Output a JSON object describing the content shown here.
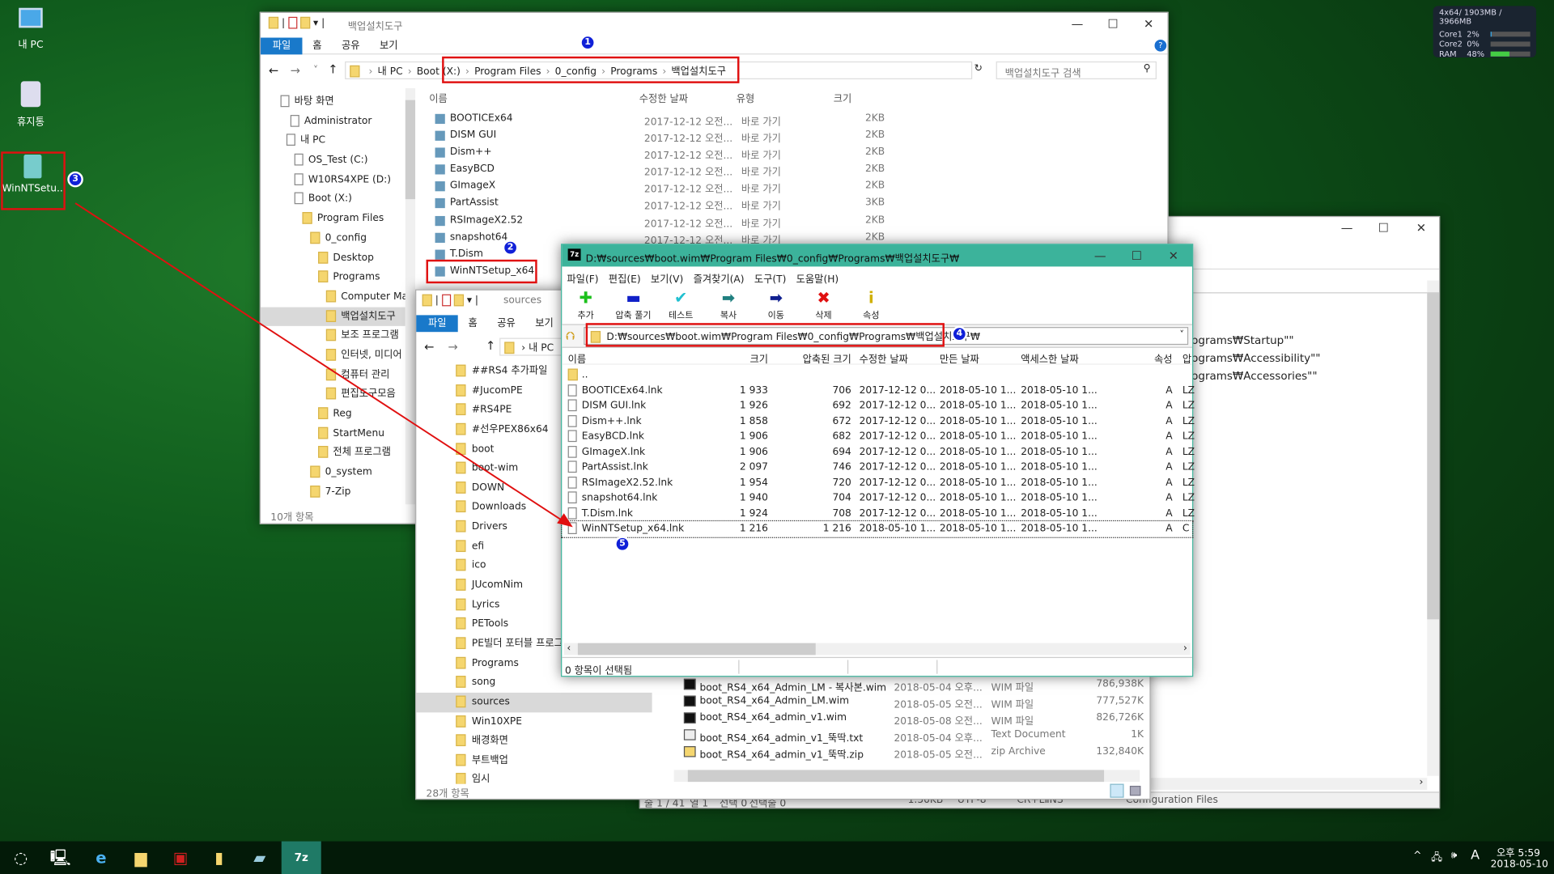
{
  "desktop": {
    "icons": [
      {
        "label": "내 PC",
        "icon": "computer-icon"
      },
      {
        "label": "휴지통",
        "icon": "recycle-bin-icon"
      },
      {
        "label": "WinNTSetu...",
        "icon": "winntsetup-icon"
      }
    ]
  },
  "sysmon": {
    "title": "4x64/ 1903MB / 3966MB",
    "rows": [
      {
        "label": "Core1",
        "value": "2%",
        "level": 2
      },
      {
        "label": "Core2",
        "value": "0%",
        "level": 0
      },
      {
        "label": "RAM",
        "value": "48%",
        "level": 48
      }
    ]
  },
  "explorer1": {
    "title": "백업설치도구",
    "tabs": [
      "파일",
      "홈",
      "공유",
      "보기"
    ],
    "breadcrumb": [
      "내 PC",
      "Boot (X:)",
      "Program Files",
      "0_config",
      "Programs",
      "백업설치도구"
    ],
    "search_placeholder": "백업설치도구 검색",
    "nav": [
      "바탕 화면",
      "Administrator",
      "내 PC",
      "OS_Test (C:)",
      "W10RS4XPE (D:)",
      "Boot (X:)",
      "Program Files",
      "0_config",
      "Desktop",
      "Programs",
      "Computer Man",
      "백업설치도구",
      "보조 프로그램",
      "인터넷, 미디어",
      "컴퓨터 관리",
      "편집도구모음",
      "Reg",
      "StartMenu",
      "전체 프로그램",
      "0_system",
      "7-Zip"
    ],
    "columns": [
      "이름",
      "수정한 날짜",
      "유형",
      "크기"
    ],
    "files": [
      {
        "name": "BOOTICEx64",
        "date": "2017-12-12 오전...",
        "type": "바로 가기",
        "size": "2KB"
      },
      {
        "name": "DISM GUI",
        "date": "2017-12-12 오전...",
        "type": "바로 가기",
        "size": "2KB"
      },
      {
        "name": "Dism++",
        "date": "2017-12-12 오전...",
        "type": "바로 가기",
        "size": "2KB"
      },
      {
        "name": "EasyBCD",
        "date": "2017-12-12 오전...",
        "type": "바로 가기",
        "size": "2KB"
      },
      {
        "name": "GImageX",
        "date": "2017-12-12 오전...",
        "type": "바로 가기",
        "size": "2KB"
      },
      {
        "name": "PartAssist",
        "date": "2017-12-12 오전...",
        "type": "바로 가기",
        "size": "3KB"
      },
      {
        "name": "RSImageX2.52",
        "date": "2017-12-12 오전...",
        "type": "바로 가기",
        "size": "2KB"
      },
      {
        "name": "snapshot64",
        "date": "2017-12-12 오전...",
        "type": "바로 가기",
        "size": "2KB"
      },
      {
        "name": "T.Dism",
        "date": "",
        "type": "",
        "size": ""
      },
      {
        "name": "WinNTSetup_x64",
        "date": "",
        "type": "",
        "size": ""
      }
    ],
    "status": "10개 항목"
  },
  "notepad": {
    "lines": [
      "rograms₩Startup\"\"",
      "rograms₩Accessibility\"\"",
      "rograms₩Accessories\"\""
    ],
    "status": [
      "줄 1 / 41",
      "열 1",
      "선택 0",
      "선택줄 0",
      "1.50KB",
      "UTF-8",
      "CR+LF",
      "INS",
      "Configuration Files"
    ]
  },
  "explorer2": {
    "title": "sources",
    "tabs": [
      "파일",
      "홈",
      "공유",
      "보기"
    ],
    "breadcrumb": [
      "내 PC"
    ],
    "nav": [
      "##RS4 추가파일",
      "#JucomPE",
      "#RS4PE",
      "#선우PEX86x64",
      "boot",
      "boot-wim",
      "DOWN",
      "Downloads",
      "Drivers",
      "efi",
      "ico",
      "JUcomNim",
      "Lyrics",
      "PETools",
      "PE빌더 포터블 프로그",
      "Programs",
      "song",
      "sources",
      "Win10XPE",
      "배경화면",
      "부트백업",
      "임시"
    ],
    "files": [
      {
        "name": "boot_RS4_x64_Admin_LM - 복사본.wim",
        "date": "2018-05-04 오후...",
        "type": "WIM 파일",
        "size": "786,938K"
      },
      {
        "name": "boot_RS4_x64_Admin_LM.wim",
        "date": "2018-05-05 오전...",
        "type": "WIM 파일",
        "size": "777,527K"
      },
      {
        "name": "boot_RS4_x64_admin_v1.wim",
        "date": "2018-05-08 오전...",
        "type": "WIM 파일",
        "size": "826,726K"
      },
      {
        "name": "boot_RS4_x64_admin_v1_뚝딱.txt",
        "date": "2018-05-04 오후...",
        "type": "Text Document",
        "size": "1K"
      },
      {
        "name": "boot_RS4_x64_admin_v1_뚝딱.zip",
        "date": "2018-05-05 오전...",
        "type": "zip Archive",
        "size": "132,840K"
      }
    ],
    "status": "28개 항목"
  },
  "sevenzip": {
    "title": "D:₩sources₩boot.wim₩Program Files₩0_config₩Programs₩백업설치도구₩",
    "menu": [
      "파일(F)",
      "편집(E)",
      "보기(V)",
      "즐겨찾기(A)",
      "도구(T)",
      "도움말(H)"
    ],
    "toolbar": [
      {
        "label": "추가",
        "icon": "add-icon",
        "glyph": "✚",
        "color": "#1bc01b"
      },
      {
        "label": "압축 풀기",
        "icon": "extract-icon",
        "glyph": "▬",
        "color": "#1020c8"
      },
      {
        "label": "테스트",
        "icon": "test-icon",
        "glyph": "✔",
        "color": "#20c0d0"
      },
      {
        "label": "복사",
        "icon": "copy-icon",
        "glyph": "➡",
        "color": "#208080"
      },
      {
        "label": "이동",
        "icon": "move-icon",
        "glyph": "➡",
        "color": "#102090"
      },
      {
        "label": "삭제",
        "icon": "delete-icon",
        "glyph": "✖",
        "color": "#e01010"
      },
      {
        "label": "속성",
        "icon": "info-icon",
        "glyph": "i",
        "color": "#d0b000"
      }
    ],
    "path": "D:₩sources₩boot.wim₩Program Files₩0_config₩Programs₩백업설치도구₩",
    "columns": [
      "이름",
      "크기",
      "압축된 크기",
      "수정한 날짜",
      "만든 날짜",
      "액세스한 날짜",
      "속성",
      "압"
    ],
    "parent": "..",
    "files": [
      {
        "name": "BOOTICEx64.lnk",
        "size": "1 933",
        "packed": "706",
        "modified": "2017-12-12 0...",
        "created": "2018-05-10 1...",
        "accessed": "2018-05-10 1...",
        "attr": "A",
        "method": "LZ"
      },
      {
        "name": "DISM GUI.lnk",
        "size": "1 926",
        "packed": "692",
        "modified": "2017-12-12 0...",
        "created": "2018-05-10 1...",
        "accessed": "2018-05-10 1...",
        "attr": "A",
        "method": "LZ"
      },
      {
        "name": "Dism++.lnk",
        "size": "1 858",
        "packed": "672",
        "modified": "2017-12-12 0...",
        "created": "2018-05-10 1...",
        "accessed": "2018-05-10 1...",
        "attr": "A",
        "method": "LZ"
      },
      {
        "name": "EasyBCD.lnk",
        "size": "1 906",
        "packed": "682",
        "modified": "2017-12-12 0...",
        "created": "2018-05-10 1...",
        "accessed": "2018-05-10 1...",
        "attr": "A",
        "method": "LZ"
      },
      {
        "name": "GImageX.lnk",
        "size": "1 906",
        "packed": "694",
        "modified": "2017-12-12 0...",
        "created": "2018-05-10 1...",
        "accessed": "2018-05-10 1...",
        "attr": "A",
        "method": "LZ"
      },
      {
        "name": "PartAssist.lnk",
        "size": "2 097",
        "packed": "746",
        "modified": "2017-12-12 0...",
        "created": "2018-05-10 1...",
        "accessed": "2018-05-10 1...",
        "attr": "A",
        "method": "LZ"
      },
      {
        "name": "RSImageX2.52.lnk",
        "size": "1 954",
        "packed": "720",
        "modified": "2017-12-12 0...",
        "created": "2018-05-10 1...",
        "accessed": "2018-05-10 1...",
        "attr": "A",
        "method": "LZ"
      },
      {
        "name": "snapshot64.lnk",
        "size": "1 940",
        "packed": "704",
        "modified": "2017-12-12 0...",
        "created": "2018-05-10 1...",
        "accessed": "2018-05-10 1...",
        "attr": "A",
        "method": "LZ"
      },
      {
        "name": "T.Dism.lnk",
        "size": "1 924",
        "packed": "708",
        "modified": "2017-12-12 0...",
        "created": "2018-05-10 1...",
        "accessed": "2018-05-10 1...",
        "attr": "A",
        "method": "LZ"
      },
      {
        "name": "WinNTSetup_x64.lnk",
        "size": "1 216",
        "packed": "1 216",
        "modified": "2018-05-10 1...",
        "created": "2018-05-10 1...",
        "accessed": "2018-05-10 1...",
        "attr": "A",
        "method": "C"
      }
    ],
    "status": "0 항목이 선택됨",
    "title_color": "#3cb39b"
  },
  "annotations": [
    "1",
    "2",
    "3",
    "4",
    "5"
  ],
  "taskbar": {
    "apps": [
      "start-icon",
      "monitor-icon",
      "ie-icon",
      "file-explorer-icon",
      "red-app-icon",
      "folder-icon",
      "notepad-icon",
      "7zip-icon"
    ],
    "time": "오후 5:59",
    "date": "2018-05-10",
    "ime": "A"
  }
}
